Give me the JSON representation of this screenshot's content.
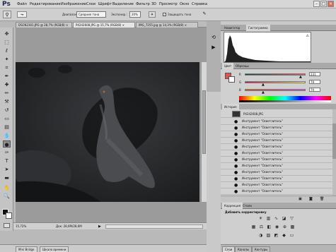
{
  "app": {
    "logo": "Ps"
  },
  "menu": {
    "items": [
      "Файл",
      "Редактирование",
      "Изображение",
      "Слои",
      "Шрифт",
      "Выделение",
      "Фильтр",
      "3D",
      "Просмотр",
      "Окно",
      "Справка"
    ]
  },
  "window_controls": {
    "minimize": "–",
    "maximize": "□",
    "close": "×"
  },
  "options_bar": {
    "diameter_label": "Диапазон:",
    "range_value": "Средние тона",
    "exposure_label": "Экспонир.:",
    "exposure_value": "20%",
    "protect_tones_label": "Защищать тона"
  },
  "document_tabs": [
    {
      "label": "DSCN2301.JPG @ 28,7% (RGB/8) ×",
      "active": false
    },
    {
      "label": "P4242608.JPG @ 15,7% (RGB/8) ×",
      "active": true
    },
    {
      "label": "IMG_7255.jpg @ 14,3% (RGB/8) ×",
      "active": false
    }
  ],
  "status": {
    "zoom": "15,72%",
    "doc": "Док: 28,6M/28,6M"
  },
  "bottom_bar": {
    "mini_bridge": "Mini Bridge",
    "timeline": "Шкала времени"
  },
  "panels": {
    "top_tabs": {
      "navigator": "Навигатор",
      "histogram": "Гистограмма"
    },
    "color_tabs": {
      "color": "Цвет",
      "swatches": "Образцы"
    },
    "color": {
      "sliders": [
        {
          "label": "R",
          "value": "231",
          "position": 0.9
        },
        {
          "label": "G",
          "value": "79",
          "position": 0.31
        },
        {
          "label": "B",
          "value": "79",
          "position": 0.31
        }
      ],
      "accent": "#e74f4f"
    },
    "history": {
      "tab_label": "История",
      "snapshot": "P4242608.JPG",
      "step_label": "Инструмент \"Осветлитель\"",
      "steps": [
        "Инструмент \"Осветлитель\"",
        "Инструмент \"Осветлитель\"",
        "Инструмент \"Осветлитель\"",
        "Инструмент \"Осветлитель\"",
        "Инструмент \"Осветлитель\"",
        "Инструмент \"Осветлитель\"",
        "Инструмент \"Осветлитель\"",
        "Инструмент \"Осветлитель\"",
        "Инструмент \"Осветлитель\"",
        "Инструмент \"Осветлитель\"",
        "Инструмент \"Осветлитель\"",
        "Инструмент \"Осветлитель\""
      ]
    },
    "adjustments": {
      "tab_label": "Коррекция",
      "styles_tab": "Стили",
      "title": "Добавить корректировку"
    },
    "bottom_tabs": {
      "layers": "Слои",
      "channels": "Каналы",
      "paths": "Контуры"
    }
  }
}
